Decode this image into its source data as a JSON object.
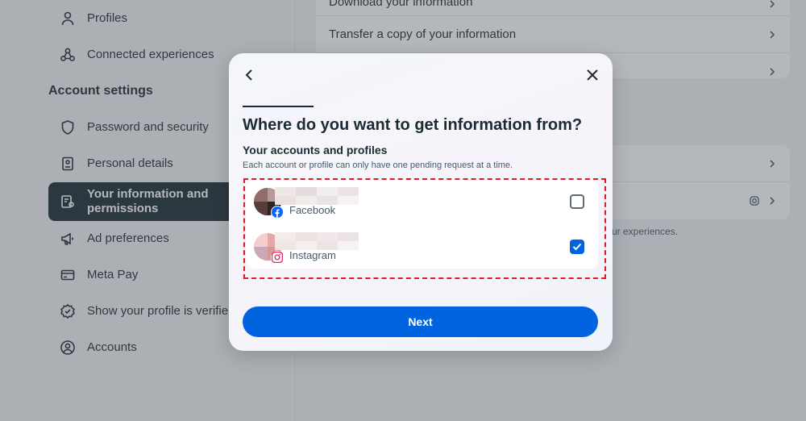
{
  "sidebar": {
    "items_top": [
      {
        "label": "Profiles",
        "icon": "person-icon"
      },
      {
        "label": "Connected experiences",
        "icon": "connected-icon"
      }
    ],
    "section_title": "Account settings",
    "items": [
      {
        "label": "Password and security",
        "icon": "shield-icon"
      },
      {
        "label": "Personal details",
        "icon": "id-card-icon"
      },
      {
        "label": "Your information and\npermissions",
        "icon": "info-permissions-icon"
      },
      {
        "label": "Ad preferences",
        "icon": "megaphone-icon"
      },
      {
        "label": "Meta Pay",
        "icon": "card-icon"
      },
      {
        "label": "Show your profile is verifie",
        "icon": "verified-icon"
      },
      {
        "label": "Accounts",
        "icon": "account-circle-icon"
      }
    ]
  },
  "main": {
    "rows": [
      {
        "label": "Download your information"
      },
      {
        "label": "Transfer a copy of your information"
      }
    ],
    "note_fragment": "ur experiences."
  },
  "modal": {
    "title": "Where do you want to get information from?",
    "subhead": "Your accounts and profiles",
    "helper": "Each account or profile can only have one pending request at a time.",
    "accounts": [
      {
        "platform": "Facebook",
        "checked": false
      },
      {
        "platform": "Instagram",
        "checked": true
      }
    ],
    "next_label": "Next"
  },
  "colors": {
    "accent": "#0064e0",
    "highlight": "#e01b24",
    "active_nav": "#1c2b33"
  }
}
